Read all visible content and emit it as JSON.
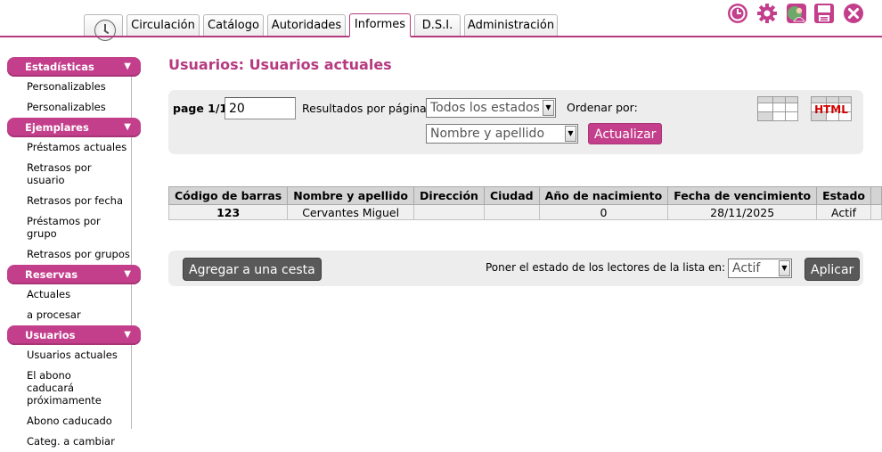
{
  "tabs": [
    {
      "label": "Circulación"
    },
    {
      "label": "Catálogo"
    },
    {
      "label": "Autoridades"
    },
    {
      "label": "Informes"
    },
    {
      "label": "D.S.I."
    },
    {
      "label": "Administración"
    }
  ],
  "active_tab": "Informes",
  "toolbar_icons": [
    "history-icon",
    "gear-icon",
    "user-globe-icon",
    "save-icon",
    "close-icon"
  ],
  "sidebar": {
    "sections": [
      {
        "title": "Estadísticas",
        "items": [
          "Personalizables",
          "Personalizables"
        ]
      },
      {
        "title": "Ejemplares",
        "items": [
          "Préstamos actuales",
          "Retrasos por usuario",
          "Retrasos por fecha",
          "Préstamos por grupo",
          "Retrasos por grupos"
        ]
      },
      {
        "title": "Reservas",
        "items": [
          "Actuales",
          "a procesar"
        ]
      },
      {
        "title": "Usuarios",
        "items": [
          "Usuarios actuales",
          "El abono caducará próximamente",
          "Abono caducado",
          "Categ. a cambiar"
        ]
      }
    ],
    "arrow": "▼"
  },
  "page_title": "Usuarios: Usuarios actuales",
  "filters": {
    "page_label": "page 1/1",
    "per_page_value": "20",
    "per_page_label": "Resultados por página",
    "status_select": "Todos los estados",
    "order_label": "Ordenar por:",
    "order_select": "Nombre y apellido",
    "update_button": "Actualizar",
    "export_html_label": "HTML"
  },
  "table": {
    "headers": [
      "Código de barras",
      "Nombre y apellido",
      "Dirección",
      "Ciudad",
      "Año de nacimiento",
      "Fecha de vencimiento",
      "Estado"
    ],
    "rows": [
      [
        "123",
        "Cervantes Miguel",
        "",
        "",
        "0",
        "28/11/2025",
        "Actif"
      ]
    ]
  },
  "actions": {
    "basket_button": "Agregar a una cesta",
    "state_label": "Poner el estado de los lectores de la lista en:",
    "state_select": "Actif",
    "apply_button": "Aplicar"
  },
  "colors": {
    "accent": "#c33f8c",
    "accent_dark": "#b53a7f",
    "panel": "#ededed"
  }
}
